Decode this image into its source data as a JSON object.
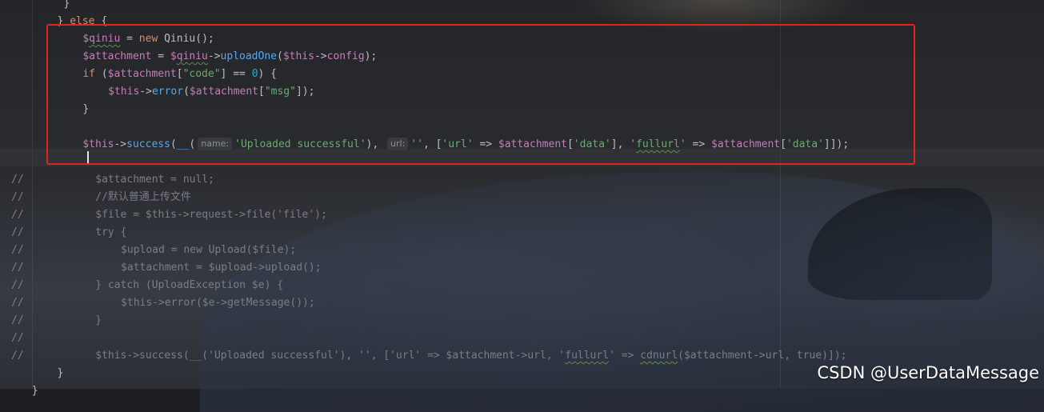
{
  "editor": {
    "lines": [
      {
        "gutter": "",
        "indent": 10,
        "tokens": [
          {
            "t": "}",
            "c": ""
          }
        ]
      },
      {
        "gutter": "",
        "indent": 9,
        "tokens": [
          {
            "t": "} ",
            "c": ""
          },
          {
            "t": "else",
            "c": "kw"
          },
          {
            "t": " {",
            "c": ""
          }
        ]
      },
      {
        "gutter": "",
        "indent": 13,
        "tokens": [
          {
            "t": "$",
            "c": "var"
          },
          {
            "t": "qiniu",
            "c": "var typo"
          },
          {
            "t": " = ",
            "c": ""
          },
          {
            "t": "new",
            "c": "kw"
          },
          {
            "t": " Qiniu();",
            "c": ""
          }
        ]
      },
      {
        "gutter": "",
        "indent": 13,
        "tokens": [
          {
            "t": "$attachment",
            "c": "var"
          },
          {
            "t": " = ",
            "c": ""
          },
          {
            "t": "$",
            "c": "var"
          },
          {
            "t": "qiniu",
            "c": "var typo"
          },
          {
            "t": "->",
            "c": ""
          },
          {
            "t": "uploadOne",
            "c": "fn"
          },
          {
            "t": "(",
            "c": ""
          },
          {
            "t": "$this",
            "c": "var"
          },
          {
            "t": "->",
            "c": ""
          },
          {
            "t": "config",
            "c": "var"
          },
          {
            "t": ");",
            "c": ""
          }
        ]
      },
      {
        "gutter": "",
        "indent": 13,
        "tokens": [
          {
            "t": "if",
            "c": "kw"
          },
          {
            "t": " (",
            "c": ""
          },
          {
            "t": "$attachment",
            "c": "var"
          },
          {
            "t": "[",
            "c": ""
          },
          {
            "t": "\"code\"",
            "c": "str"
          },
          {
            "t": "] == ",
            "c": ""
          },
          {
            "t": "0",
            "c": "num"
          },
          {
            "t": ") {",
            "c": ""
          }
        ]
      },
      {
        "gutter": "",
        "indent": 17,
        "tokens": [
          {
            "t": "$this",
            "c": "var"
          },
          {
            "t": "->",
            "c": ""
          },
          {
            "t": "error",
            "c": "fn"
          },
          {
            "t": "(",
            "c": ""
          },
          {
            "t": "$attachment",
            "c": "var"
          },
          {
            "t": "[",
            "c": ""
          },
          {
            "t": "\"msg\"",
            "c": "str"
          },
          {
            "t": "]);",
            "c": ""
          }
        ]
      },
      {
        "gutter": "",
        "indent": 13,
        "tokens": [
          {
            "t": "}",
            "c": ""
          }
        ]
      },
      {
        "gutter": "",
        "indent": 0,
        "tokens": []
      },
      {
        "gutter": "",
        "indent": 13,
        "tokens": [
          {
            "t": "$this",
            "c": "var"
          },
          {
            "t": "->",
            "c": ""
          },
          {
            "t": "success",
            "c": "fn"
          },
          {
            "t": "(",
            "c": ""
          },
          {
            "t": "__",
            "c": "fn"
          },
          {
            "t": "(",
            "c": ""
          },
          {
            "hint": "name:"
          },
          {
            "t": "'Uploaded successful'",
            "c": "str"
          },
          {
            "t": "), ",
            "c": ""
          },
          {
            "hint": "url:"
          },
          {
            "t": "''",
            "c": "str"
          },
          {
            "t": ", [",
            "c": ""
          },
          {
            "t": "'url'",
            "c": "str"
          },
          {
            "t": " => ",
            "c": ""
          },
          {
            "t": "$attachment",
            "c": "var"
          },
          {
            "t": "[",
            "c": ""
          },
          {
            "t": "'data'",
            "c": "str"
          },
          {
            "t": "], ",
            "c": ""
          },
          {
            "t": "'",
            "c": "str"
          },
          {
            "t": "fullurl",
            "c": "str typo"
          },
          {
            "t": "'",
            "c": "str"
          },
          {
            "t": " => ",
            "c": ""
          },
          {
            "t": "$attachment",
            "c": "var"
          },
          {
            "t": "[",
            "c": ""
          },
          {
            "t": "'data'",
            "c": "str"
          },
          {
            "t": "]]);",
            "c": ""
          }
        ]
      },
      {
        "gutter": "",
        "indent": 0,
        "tokens": []
      },
      {
        "gutter": "//",
        "indent": 15,
        "tokens": [
          {
            "t": "$attachment = null;",
            "c": "cm"
          }
        ]
      },
      {
        "gutter": "//",
        "indent": 15,
        "tokens": [
          {
            "t": "//默认普通上传文件",
            "c": "cm"
          }
        ]
      },
      {
        "gutter": "//",
        "indent": 15,
        "tokens": [
          {
            "t": "$file = $this->request->file('file');",
            "c": "cm"
          }
        ]
      },
      {
        "gutter": "//",
        "indent": 15,
        "tokens": [
          {
            "t": "try {",
            "c": "cm"
          }
        ]
      },
      {
        "gutter": "//",
        "indent": 19,
        "tokens": [
          {
            "t": "$upload = new Upload($file);",
            "c": "cm"
          }
        ]
      },
      {
        "gutter": "//",
        "indent": 19,
        "tokens": [
          {
            "t": "$attachment = $upload->upload();",
            "c": "cm"
          }
        ]
      },
      {
        "gutter": "//",
        "indent": 15,
        "tokens": [
          {
            "t": "} catch (UploadException $e) {",
            "c": "cm"
          }
        ]
      },
      {
        "gutter": "//",
        "indent": 19,
        "tokens": [
          {
            "t": "$this->error($e->getMessage());",
            "c": "cm"
          }
        ]
      },
      {
        "gutter": "//",
        "indent": 15,
        "tokens": [
          {
            "t": "}",
            "c": "cm"
          }
        ]
      },
      {
        "gutter": "//",
        "indent": 0,
        "tokens": []
      },
      {
        "gutter": "//",
        "indent": 15,
        "tokens": [
          {
            "t": "$this->success(__('Uploaded successful'), '', ['url' => $attachment->url, '",
            "c": "cm"
          },
          {
            "t": "fullurl",
            "c": "cm typo"
          },
          {
            "t": "' => ",
            "c": "cm"
          },
          {
            "t": "cdnurl",
            "c": "cm typo"
          },
          {
            "t": "($attachment->url, true)]);",
            "c": "cm"
          }
        ]
      },
      {
        "gutter": "",
        "indent": 9,
        "tokens": [
          {
            "t": "}",
            "c": ""
          }
        ]
      },
      {
        "gutter": "",
        "indent": 5,
        "tokens": [
          {
            "t": "}",
            "c": ""
          }
        ]
      }
    ]
  },
  "watermark": "CSDN @UserDataMessage",
  "colors": {
    "highlight_border": "#e0251f",
    "keyword": "#cf8e6d",
    "variable": "#c77dbb",
    "function": "#56a8f5",
    "string": "#6aab73",
    "number": "#2aacb8",
    "comment": "#7a7e85"
  }
}
